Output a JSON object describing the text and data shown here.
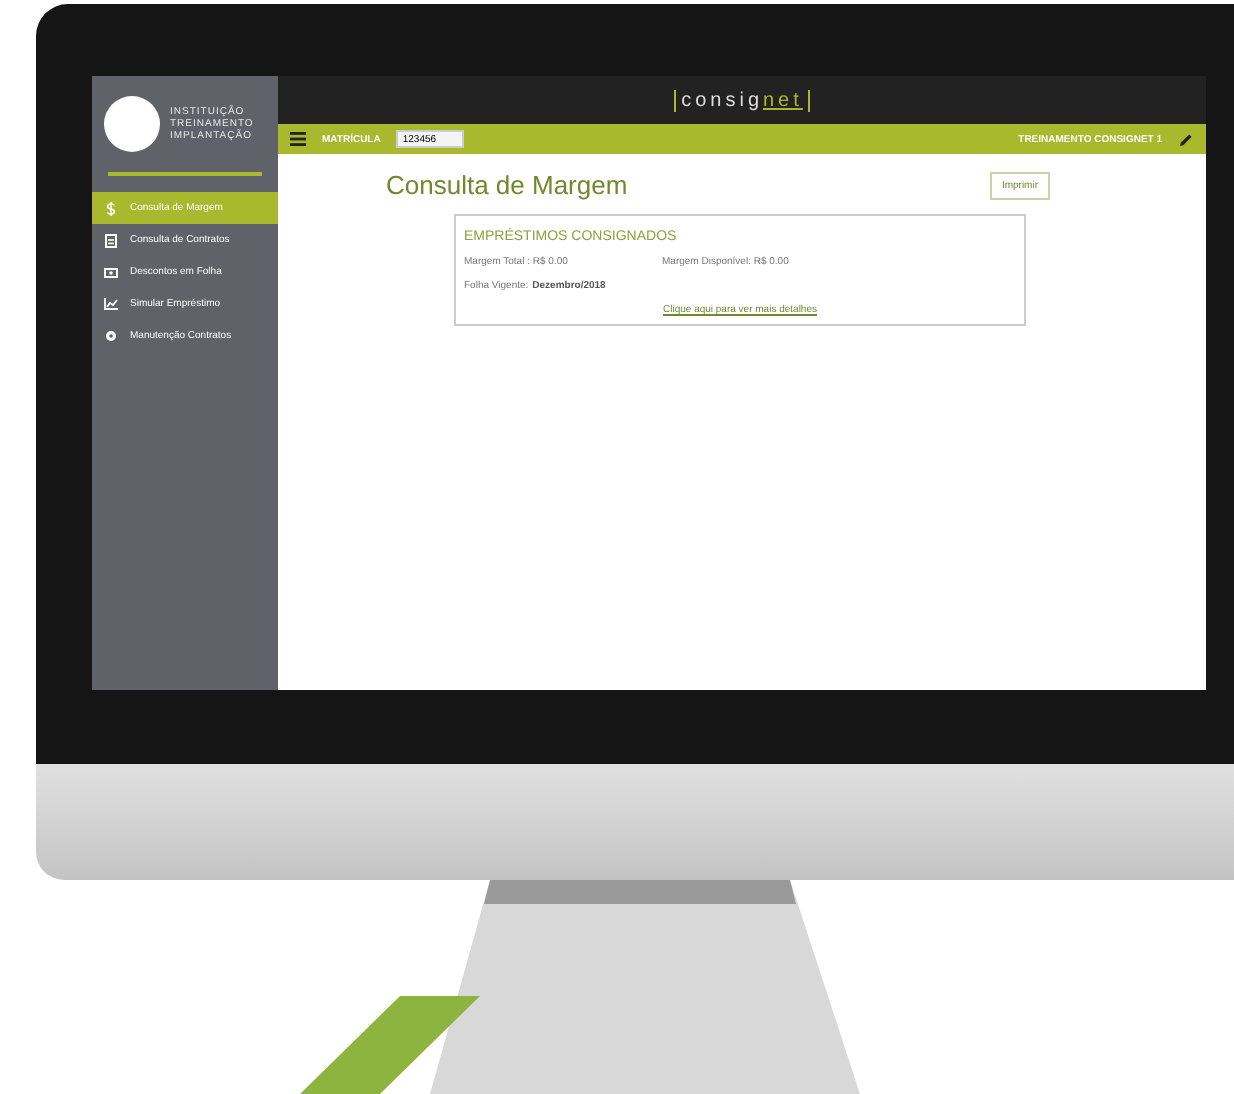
{
  "sidebar": {
    "institution_lines": [
      "INSTITUIÇÃO",
      "TREINAMENTO",
      "IMPLANTAÇÃO"
    ],
    "items": [
      {
        "label": "Consulta de Margem",
        "kind": "dollar",
        "selected": true
      },
      {
        "label": "Consulta de Contratos",
        "kind": "document",
        "selected": false
      },
      {
        "label": "Descontos em Folha",
        "kind": "money",
        "selected": false
      },
      {
        "label": "Simular Empréstimo",
        "kind": "chart",
        "selected": false
      },
      {
        "label": "Manutenção Contratos",
        "kind": "gear",
        "selected": false
      }
    ]
  },
  "header": {
    "brand_prefix": "consig",
    "brand_suffix": "net"
  },
  "toolbar": {
    "matricula_label": "MATRÍCULA",
    "matricula_value": "123456",
    "user": "TREINAMENTO CONSIGNET 1"
  },
  "page": {
    "title": "Consulta de Margem",
    "print_button": "Imprimir",
    "card": {
      "title": "EMPRÉSTIMOS CONSIGNADOS",
      "margem_total": "Margem Total : R$ 0.00",
      "margem_disponivel": "Margem Disponível: R$ 0.00",
      "folha_label": "Folha Vigente:",
      "folha_value": "Dezembro/2018",
      "details_link": "Clique aqui para ver mais detalhes"
    }
  }
}
